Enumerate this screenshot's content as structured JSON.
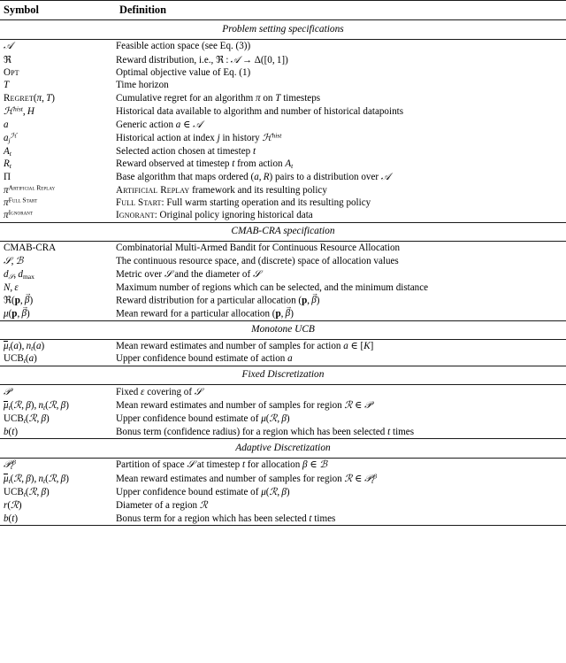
{
  "table": {
    "columns": [
      "Symbol",
      "Definition"
    ],
    "sections": [
      {
        "title": "Problem setting specifications",
        "rows": [
          {
            "symbol": "𝒜",
            "definition": "Feasible action space (see Eq. (3))"
          },
          {
            "symbol": "ℜ",
            "definition": "Reward distribution, i.e., ℜ : 𝒜 → Δ([0, 1])"
          },
          {
            "symbol": "Opt",
            "definition": "Optimal objective value of Eq. (1)"
          },
          {
            "symbol": "T",
            "definition": "Time horizon"
          },
          {
            "symbol": "Regret(π, T)",
            "definition": "Cumulative regret for an algorithm π on T timesteps"
          },
          {
            "symbol": "ℋhist, H",
            "definition": "Historical data available to algorithm and number of historical datapoints"
          },
          {
            "symbol": "a",
            "definition": "Generic action a ∈ 𝒜"
          },
          {
            "symbol": "a_j^ℋ",
            "definition": "Historical action at index j in history ℋhist"
          },
          {
            "symbol": "A_t",
            "definition": "Selected action chosen at timestep t"
          },
          {
            "symbol": "R_t",
            "definition": "Reward observed at timestep t from action A_t"
          },
          {
            "symbol": "Π",
            "definition": "Base algorithm that maps ordered (a, R) pairs to a distribution over 𝒜"
          },
          {
            "symbol": "π^Artificial Replay",
            "definition": "Artificial Replay framework and its resulting policy"
          },
          {
            "symbol": "π^Full Start",
            "definition": "Full Start: Full warm starting operation and its resulting policy"
          },
          {
            "symbol": "π^Ignorant",
            "definition": "Ignorant: Original policy ignoring historical data"
          }
        ]
      },
      {
        "title": "CMAB-CRA specification",
        "rows": [
          {
            "symbol": "CMAB-CRA",
            "definition": "Combinatorial Multi-Armed Bandit for Continuous Resource Allocation"
          },
          {
            "symbol": "𝒮, ℬ",
            "definition": "The continuous resource space, and (discrete) space of allocation values"
          },
          {
            "symbol": "d_𝒮, d_max",
            "definition": "Metric over 𝒮 and the diameter of 𝒮"
          },
          {
            "symbol": "N, ε",
            "definition": "Maximum number of regions which can be selected, and the minimum distance"
          },
          {
            "symbol": "ℜ(p, β⃗)",
            "definition": "Reward distribution for a particular allocation (p, β⃗)"
          },
          {
            "symbol": "μ(p, β⃗)",
            "definition": "Mean reward for a particular allocation (p, β⃗)"
          }
        ]
      },
      {
        "title": "Monotone UCB",
        "rows": [
          {
            "symbol": "μ̄_t(a), n_t(a)",
            "definition": "Mean reward estimates and number of samples for action a ∈ [K]"
          },
          {
            "symbol": "UCB_t(a)",
            "definition": "Upper confidence bound estimate of action a"
          }
        ]
      },
      {
        "title": "Fixed Discretization",
        "rows": [
          {
            "symbol": "𝒫",
            "definition": "Fixed ε covering of 𝒮"
          },
          {
            "symbol": "μ̄_t(ℛ, β), n_t(ℛ, β)",
            "definition": "Mean reward estimates and number of samples for region ℛ ∈ 𝒫"
          },
          {
            "symbol": "UCB_t(ℛ, β)",
            "definition": "Upper confidence bound estimate of μ(ℛ, β)"
          },
          {
            "symbol": "b(t)",
            "definition": "Bonus term (confidence radius) for a region which has been selected t times"
          }
        ]
      },
      {
        "title": "Adaptive Discretization",
        "rows": [
          {
            "symbol": "𝒫_t^β",
            "definition": "Partition of space 𝒮 at timestep t for allocation β ∈ ℬ"
          },
          {
            "symbol": "μ̄_t(ℛ, β), n_t(ℛ, β)",
            "definition": "Mean reward estimates and number of samples for region ℛ ∈ 𝒫_t^β"
          },
          {
            "symbol": "UCB_t(ℛ, β)",
            "definition": "Upper confidence bound estimate of μ(ℛ, β)"
          },
          {
            "symbol": "r(ℛ)",
            "definition": "Diameter of a region ℛ"
          },
          {
            "symbol": "b(t)",
            "definition": "Bonus term for a region which has been selected t times"
          }
        ]
      }
    ]
  },
  "style": {
    "rule_color": "#1a1a1a",
    "text_color": "#000000",
    "background": "#ffffff"
  }
}
